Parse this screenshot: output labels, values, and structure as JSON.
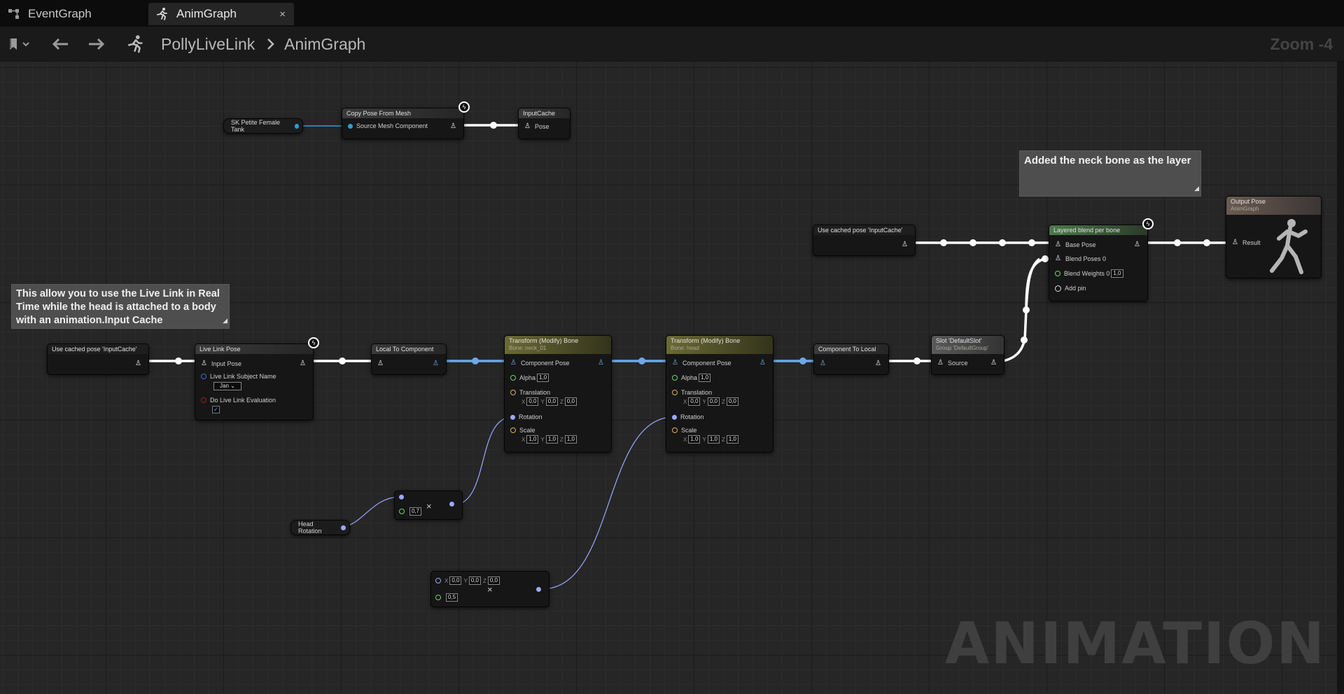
{
  "tabs": [
    {
      "label": "EventGraph",
      "icon": "graph-icon"
    },
    {
      "label": "AnimGraph",
      "icon": "running-man-icon"
    }
  ],
  "tab_close": "×",
  "toolbar": {
    "breadcrumb": [
      "PollyLiveLink",
      "AnimGraph"
    ],
    "separator": ">",
    "zoom": "Zoom -4"
  },
  "comments": {
    "neck": "Added the neck bone as the layer",
    "livelink": "This allow you to use the Live Link in Real Time while the head is attached to a body with an animation.Input Cache"
  },
  "nodes": {
    "sk_var": "SK Petite Female Tank",
    "copy_pose": {
      "title": "Copy Pose From Mesh",
      "pin": "Source Mesh Component"
    },
    "input_cache": {
      "title": "InputCache",
      "pin": "Pose"
    },
    "cached_top": "Use cached pose 'InputCache'",
    "cached_left": "Use cached pose 'InputCache'",
    "layered": {
      "title": "Layered blend per bone",
      "base": "Base Pose",
      "blend": "Blend Poses 0",
      "weights": "Blend Weights 0",
      "weights_val": "1,0",
      "add": "Add pin"
    },
    "output": {
      "title": "Output Pose",
      "sub": "AnimGraph",
      "pin": "Result"
    },
    "live_link": {
      "title": "Live Link Pose",
      "input": "Input Pose",
      "subject_label": "Live Link Subject Name",
      "subject": "Jan",
      "eval": "Do Live Link Evaluation"
    },
    "local_to_comp": "Local To Component",
    "tm1": {
      "title": "Transform (Modify) Bone",
      "sub": "Bone: neck_01"
    },
    "tm2": {
      "title": "Transform (Modify) Bone",
      "sub": "Bone: head"
    },
    "tm_labels": {
      "pose": "Component Pose",
      "alpha": "Alpha",
      "alpha_val": "1,0",
      "translation": "Translation",
      "rotation": "Rotation",
      "scale": "Scale",
      "zero": "0,0",
      "one": "1,0",
      "x": "X",
      "y": "Y",
      "z": "Z"
    },
    "comp_to_local": "Component To Local",
    "slot": {
      "title": "Slot 'DefaultSlot'",
      "sub": "Group 'DefaultGroup'",
      "pin": "Source"
    },
    "multiply1_val": "0,7",
    "head_rotation": "Head Rotation",
    "multiply2": {
      "x": "0,0",
      "y": "0,0",
      "z": "0,0",
      "scalar": "0,5"
    }
  },
  "watermark": "ANIMATION",
  "colors": {
    "exec_white": "#ffffff",
    "pose_blue": "#6fa8e8",
    "rotator": "#9aa8ff",
    "float_green": "#6ed36e",
    "vector_orange": "#e0b050",
    "object_blue": "#2a9fd6"
  }
}
